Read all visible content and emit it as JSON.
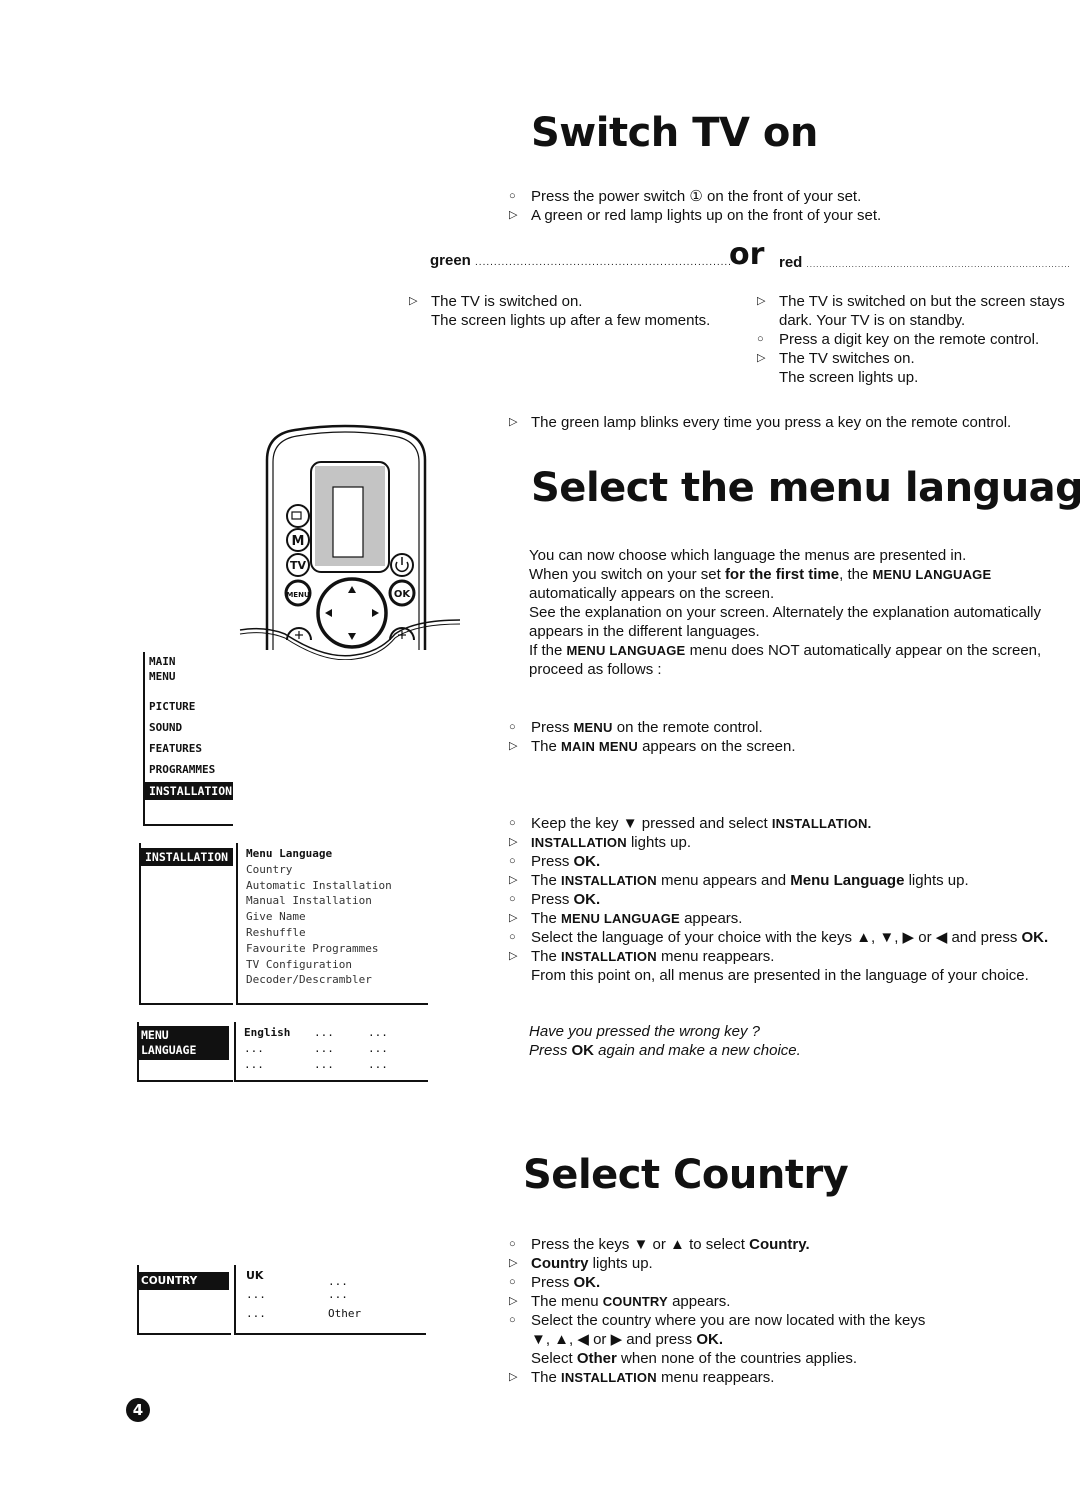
{
  "page_number": "4",
  "switch_on": {
    "title": "Switch TV on",
    "steps": [
      {
        "marker": "circle",
        "text": "Press the power switch ① on the front of your set."
      },
      {
        "marker": "triangle",
        "text": "A green or red lamp lights up on the front of your set."
      }
    ],
    "lamp_green_label": "green",
    "lamp_or_label": "or",
    "lamp_red_label": "red",
    "green_result": {
      "line1": "The TV is switched on.",
      "line2": "The screen lights up after a few moments."
    },
    "red_result": {
      "line1": "The TV is switched on but the screen stays",
      "line2": "dark. Your TV is on standby.",
      "line3": "Press a digit key on the remote control.",
      "line4": "The TV switches on.",
      "line5": "The screen lights up."
    },
    "blink_note": "The green lamp blinks every time you press a key on the remote control."
  },
  "menu_language": {
    "title": "Select the menu language",
    "intro": {
      "l1": "You can now choose which language the menus are presented in.",
      "l2a": "When you switch on your set ",
      "l2b": "for the first time",
      "l2c": ", the ",
      "l2d": "MENU LANGUAGE",
      "l3": "automatically appears on the screen.",
      "l4": "See the explanation on your screen.  Alternately the explanation automatically",
      "l5": "appears in the different languages.",
      "l6a": "If the ",
      "l6b": "MENU LANGUAGE",
      "l6c": " menu does NOT automatically appear on the screen,",
      "l7": "proceed as follows :"
    },
    "press_menu": {
      "a1": "Press ",
      "a2": "MENU",
      "a3": " on the remote control.",
      "b1": "The ",
      "b2": "MAIN MENU",
      "b3": " appears on the screen."
    },
    "steps": {
      "s1a": "Keep the key ▼ pressed and select ",
      "s1b": "INSTALLATION.",
      "s2a": "INSTALLATION",
      "s2b": " lights up.",
      "s3a": "Press ",
      "s3b": "OK.",
      "s4a": "The ",
      "s4b": "INSTALLATION",
      "s4c": " menu appears and ",
      "s4d": "Menu Language",
      "s4e": " lights up.",
      "s5a": "Press ",
      "s5b": "OK.",
      "s6a": "The ",
      "s6b": "MENU LANGUAGE",
      "s6c": " appears.",
      "s7a": "Select the language of your choice with the keys ▲, ▼, ▶ or ◀ and press ",
      "s7b": "OK.",
      "s8a": "The ",
      "s8b": "INSTALLATION",
      "s8c": " menu reappears.",
      "s9": "From this point on, all menus are presented in the language of your choice."
    },
    "tip": {
      "l1": "Have you pressed the wrong key ?",
      "l2a": "Press ",
      "l2b": "OK",
      "l2c": " again and make a new choice."
    }
  },
  "select_country": {
    "title": "Select Country",
    "steps": {
      "s1a": "Press the keys ▼ or ▲  to select ",
      "s1b": "Country.",
      "s2a": "Country",
      "s2b": " lights up.",
      "s3a": "Press ",
      "s3b": "OK.",
      "s4a": "The menu ",
      "s4b": "COUNTRY",
      "s4c": " appears.",
      "s5": "Select the country where you are now located with the keys",
      "s6a": "▼, ▲, ◀ or ▶ and press ",
      "s6b": "OK.",
      "s7a": "Select ",
      "s7b": "Other",
      "s7c": " when none of the countries applies.",
      "s8a": "The ",
      "s8b": "INSTALLATION",
      "s8c": " menu reappears."
    }
  },
  "osd_main_menu": {
    "title_l1": "MAIN",
    "title_l2": "MENU",
    "items": [
      "PICTURE",
      "SOUND",
      "FEATURES",
      "PROGRAMMES"
    ],
    "selected": "INSTALLATION"
  },
  "osd_installation": {
    "header": "INSTALLATION",
    "items": [
      "Menu Language",
      "Country",
      "Automatic Installation",
      "Manual Installation",
      "Give Name",
      "Reshuffle",
      "Favourite Programmes",
      "TV Configuration",
      "Decoder/Descrambler"
    ],
    "selected_index": 0
  },
  "osd_menu_language": {
    "header_l1": "MENU",
    "header_l2": "LANGUAGE",
    "grid": [
      [
        "English",
        "...",
        "..."
      ],
      [
        "...",
        "...",
        "..."
      ],
      [
        "...",
        "...",
        "..."
      ]
    ]
  },
  "osd_country": {
    "header": "COUNTRY",
    "grid": [
      [
        "UK",
        "..."
      ],
      [
        "...",
        "..."
      ],
      [
        "...",
        "Other"
      ]
    ]
  },
  "remote": {
    "buttons": [
      "input",
      "M",
      "TV",
      "power",
      "MENU",
      "OK",
      "up",
      "down",
      "left",
      "right",
      "minus",
      "plus"
    ],
    "labels": {
      "m": "M",
      "tv": "TV",
      "menu": "MENU",
      "ok": "OK"
    }
  },
  "markers": {
    "circle": "○",
    "triangle": "▷"
  }
}
